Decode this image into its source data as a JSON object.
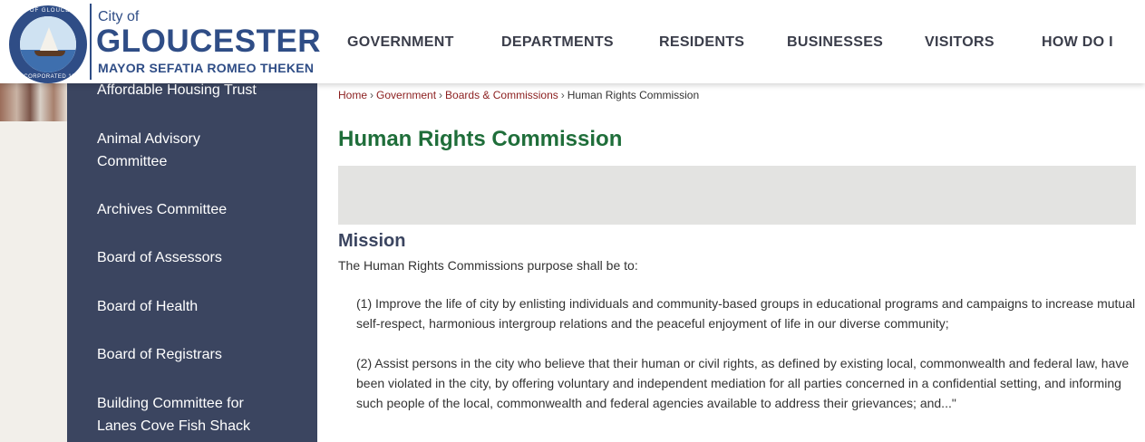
{
  "header": {
    "seal_top_text": "CITY OF GLOUCESTER",
    "seal_bottom_text": "INCORPORATED 1873",
    "city_of": "City of",
    "city_name": "GLOUCESTER",
    "mayor": "MAYOR SEFATIA ROMEO THEKEN",
    "brand_color": "#2f4d86"
  },
  "nav": {
    "items": [
      {
        "label": "GOVERNMENT"
      },
      {
        "label": "DEPARTMENTS"
      },
      {
        "label": "RESIDENTS"
      },
      {
        "label": "BUSINESSES"
      },
      {
        "label": "VISITORS"
      },
      {
        "label": "HOW DO I"
      }
    ]
  },
  "sidebar": {
    "color": "#3b4560",
    "items": [
      {
        "label": "Affordable Housing Trust"
      },
      {
        "label": "Animal Advisory Committee"
      },
      {
        "label": "Archives Committee"
      },
      {
        "label": "Board of Assessors"
      },
      {
        "label": "Board of Health"
      },
      {
        "label": "Board of Registrars"
      },
      {
        "label": "Building Committee for Lanes Cove Fish Shack"
      }
    ]
  },
  "breadcrumb": {
    "home": "Home",
    "government": "Government",
    "boards": "Boards & Commissions",
    "current": "Human Rights Commission",
    "separator": "›"
  },
  "main": {
    "title": "Human Rights Commission",
    "title_color": "#1f6e3a",
    "section_heading": "Mission",
    "intro": "The Human Rights Commissions purpose shall be to:",
    "paragraphs": [
      "(1) Improve the life of city by enlisting individuals and community-based groups in educational programs and campaigns to increase mutual self-respect, harmonious intergroup relations and the peaceful enjoyment of life in our diverse community;",
      "(2) Assist persons in the city who believe that their human or civil rights, as defined by existing local, commonwealth and federal law, have been violated in the city, by offering voluntary and independent mediation for all parties concerned in a confidential setting, and informing such people of the local, commonwealth and federal agencies available to address their grievances; and...\""
    ]
  }
}
